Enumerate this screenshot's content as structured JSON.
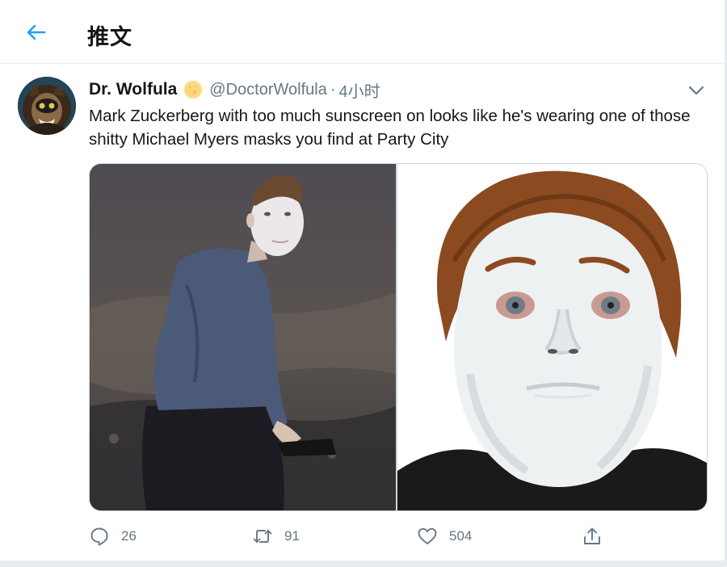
{
  "header": {
    "title": "推文",
    "back_icon": "arrow-left-icon"
  },
  "tweet": {
    "display_name": "Dr. Wolfula",
    "handle": "@DoctorWolfula",
    "separator": "·",
    "time": "4小时",
    "text": "Mark Zuckerberg with too much sunscreen on looks like he's wearing one of those shitty Michael Myers masks you find at Party City",
    "media": [
      {
        "icon": "photo-man-in-blue-shirt-with-white-face"
      },
      {
        "icon": "photo-white-halloween-mask"
      }
    ],
    "actions": {
      "reply_count": "26",
      "retweet_count": "91",
      "like_count": "504"
    }
  },
  "colors": {
    "accent": "#1da1f2",
    "secondary_text": "#657786",
    "border": "#e6ecf0"
  }
}
